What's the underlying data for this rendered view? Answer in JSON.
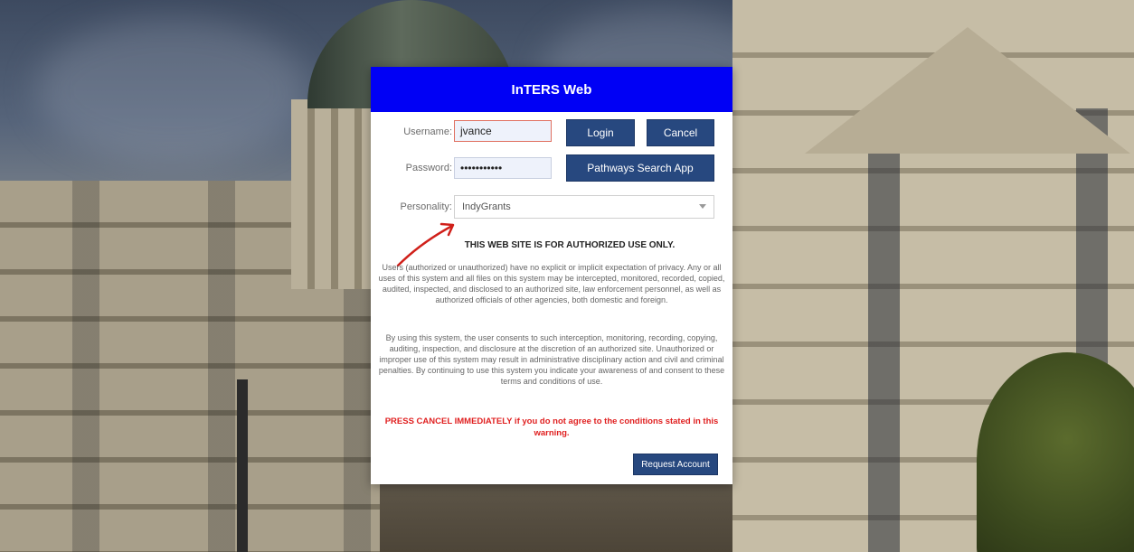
{
  "dialog": {
    "title": "InTERS Web",
    "username_label": "Username:",
    "username_value": "jvance",
    "password_label": "Password:",
    "password_value": "•••••••••••",
    "personality_label": "Personality:",
    "personality_value": "IndyGrants",
    "login_label": "Login",
    "cancel_label": "Cancel",
    "pathways_label": "Pathways Search App",
    "warning_title": "THIS WEB SITE IS FOR AUTHORIZED USE ONLY.",
    "paragraph1": "Users (authorized or unauthorized) have no explicit or implicit expectation of privacy. Any or all uses of this system and all files on this system may be intercepted, monitored, recorded, copied, audited, inspected, and disclosed to an authorized site, law enforcement personnel, as well as authorized officials of other agencies, both domestic and foreign.",
    "paragraph2": "By using this system, the user consents to such interception, monitoring, recording, copying, auditing, inspection, and disclosure at the discretion of an authorized site. Unauthorized or improper use of this system may result in administrative disciplinary action and civil and criminal penalties. By continuing to use this system you indicate your awareness of and consent to these terms and conditions of use.",
    "red_warning": "PRESS CANCEL IMMEDIATELY if you do not agree to the conditions stated in this warning.",
    "request_account_label": "Request Account"
  },
  "colors": {
    "header": "#0000f5",
    "button": "#27487f",
    "warning": "#e02020",
    "annotation_arrow": "#d0201a"
  },
  "icons": {
    "personality_dropdown": "chevron-down-icon",
    "annotation": "red-arrow-annotation"
  }
}
